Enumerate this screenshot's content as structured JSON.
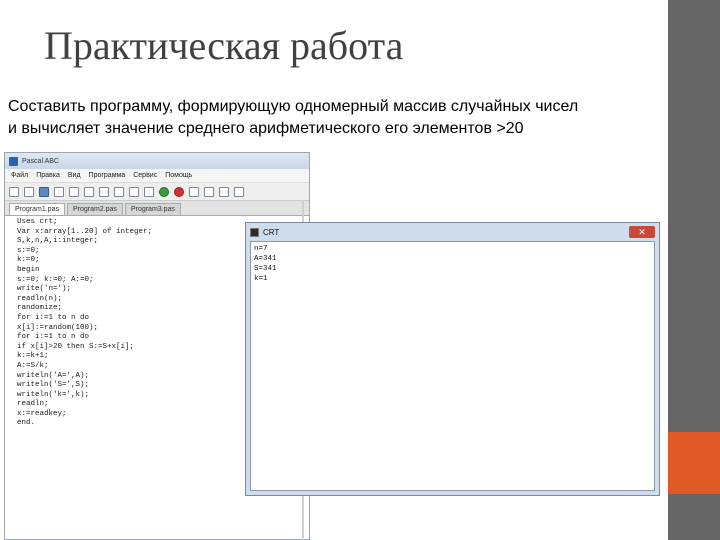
{
  "slide": {
    "title": "Практическая работа",
    "text_line1": "Составить программу, формирующую одномерный массив случайных чисел",
    "text_line2": "и вычисляет значение среднего арифметического его элементов >20"
  },
  "ide": {
    "window_title": "Pascal ABC",
    "menu": [
      "Файл",
      "Правка",
      "Вид",
      "Программа",
      "Сервис",
      "Помощь"
    ],
    "tabs": [
      "Program1.pas",
      "Program2.pas",
      "Program3.pas"
    ],
    "code": [
      "Uses crt;",
      "Var x:array[1..20] of integer;",
      "S,k,n,A,i:integer;",
      "s:=0;",
      "k:=0;",
      "begin",
      "s:=0; k:=0; A:=0;",
      "write('n=');",
      "readln(n);",
      "randomize;",
      "for i:=1 to n do",
      "x[i]:=random(100);",
      "for i:=1 to n do",
      "if x[i]>20 then S:=S+x[i];",
      "k:=k+1;",
      "A:=S/k;",
      "writeln('A=',A);",
      "writeln('S=',S);",
      "writeln('k=',k);",
      "readln;",
      "x:=readkey;",
      "end."
    ]
  },
  "crt": {
    "title": "CRT",
    "close_label": "✕",
    "output": [
      "n=7",
      "A=341",
      "S=341",
      "k=1"
    ]
  },
  "colors": {
    "right_band": "#666666",
    "accent": "#e05a28",
    "title_text": "#404040"
  }
}
